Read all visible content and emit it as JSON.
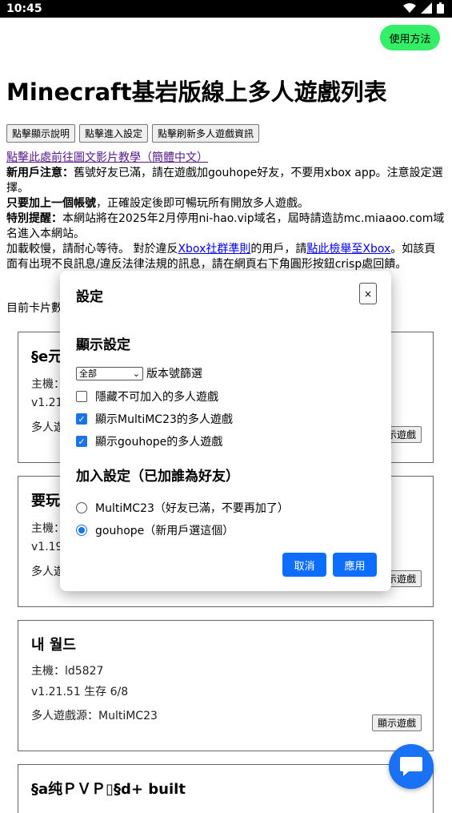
{
  "status": {
    "time": "10:45",
    "wifi_icon": "wifi-icon",
    "signal_icon": "signal-icon",
    "battery_icon": "battery-icon"
  },
  "help_button": "使用方法",
  "title": "Minecraft基岩版線上多人遊戲列表",
  "buttons": [
    "點擊顯示說明",
    "點擊進入設定",
    "點擊刷新多人遊戲資訊"
  ],
  "notice": {
    "video_link": "點擊此處前往圖文影片教學（簡體中文）",
    "new_user_label": "新用戶注意：",
    "new_user_text": "舊號好友已滿，請在遊戲加gouhope好友，不要用xbox app。注意設定選擇。",
    "only_add_label": "只要加上一個帳號",
    "only_add_text": "，正確設定後即可暢玩所有開放多人遊戲。",
    "special_label": "特別提醒：",
    "special_text": "本網站將在2025年2月停用ni-hao.vip域名，屆時請造訪mc.miaaoo.com域名進入本網站。",
    "loading_text_1": "加載較慢，請耐心等待。 對於違反",
    "xbox_rules_link": "Xbox社群準則",
    "loading_text_2": "的用戶，請",
    "report_link": "點此檢舉至Xbox",
    "loading_text_3": "。如該頁面有出現不良訊息/違反法律法規的訊息，請在網頁右下角圓形按鈕crisp處回饋。"
  },
  "count_label": "目前卡片數",
  "cards": [
    {
      "title": "§e元",
      "host": "主機：",
      "version": "v1.21",
      "source": "多人遊",
      "button": "示遊戲"
    },
    {
      "title": "要玩",
      "host": "主機：",
      "version": "v1.19",
      "source": "多人遊",
      "button": "示遊戲"
    },
    {
      "title": "내 월드",
      "host": "主機：ld5827",
      "version": "v1.21.51 生存 6/8",
      "source": "多人遊戲源：MultiMC23",
      "button": "顯示遊戲"
    },
    {
      "title": "§a纯ＰＶＰ▯§d+ built"
    }
  ],
  "modal": {
    "title": "設定",
    "close": "×",
    "display_section": "顯示設定",
    "version_select": "全部",
    "version_filter_label": "版本號篩選",
    "checkboxes": [
      {
        "label": "隱藏不可加入的多人遊戲",
        "checked": false
      },
      {
        "label": "顯示MultiMC23的多人遊戲",
        "checked": true
      },
      {
        "label": "顯示gouhope的多人遊戲",
        "checked": true
      }
    ],
    "join_section": "加入設定（已加誰為好友）",
    "radios": [
      {
        "label": "MultiMC23（好友已滿，不要再加了）",
        "selected": false
      },
      {
        "label": "gouhope（新用戶選這個）",
        "selected": true
      }
    ],
    "cancel": "取消",
    "apply": "應用"
  },
  "chat_icon": "chat-bubble-icon"
}
